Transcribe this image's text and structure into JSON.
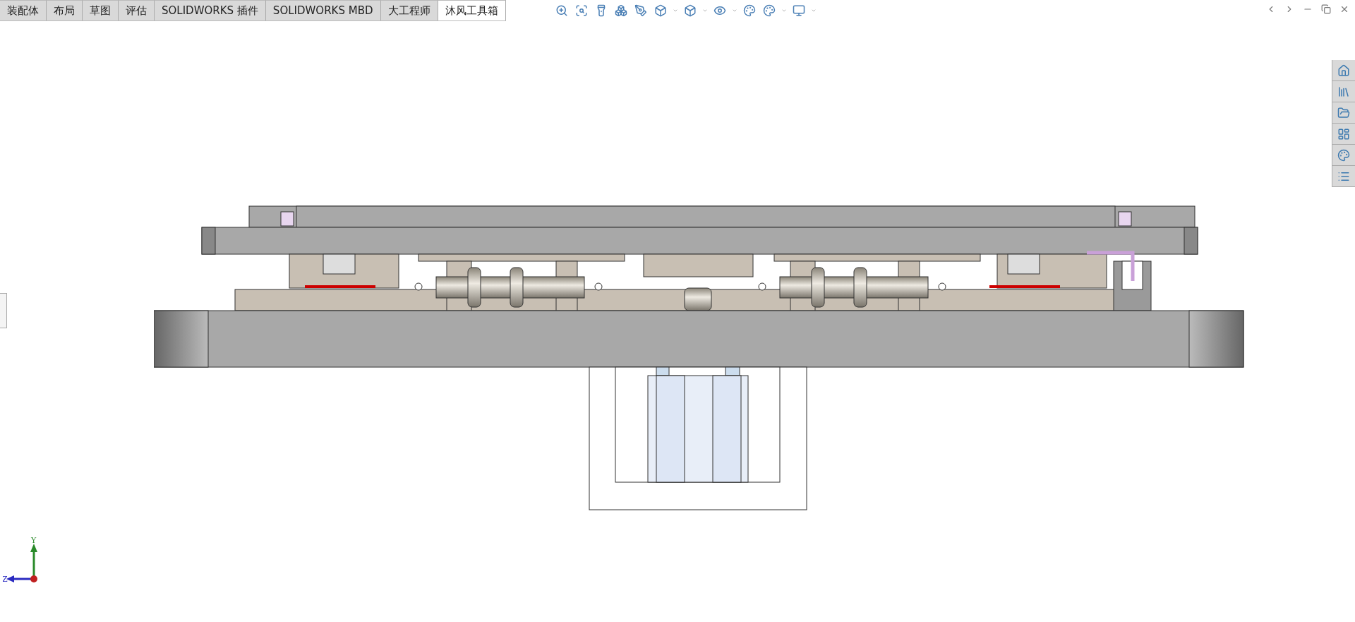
{
  "tabs": [
    {
      "label": "装配体",
      "selected": false
    },
    {
      "label": "布局",
      "selected": false
    },
    {
      "label": "草图",
      "selected": false
    },
    {
      "label": "评估",
      "selected": false
    },
    {
      "label": "SOLIDWORKS 插件",
      "selected": false
    },
    {
      "label": "SOLIDWORKS MBD",
      "selected": false
    },
    {
      "label": "大工程师",
      "selected": false
    },
    {
      "label": "沐风工具箱",
      "selected": true
    }
  ],
  "triad": {
    "y_label": "Y",
    "z_label": "Z"
  }
}
